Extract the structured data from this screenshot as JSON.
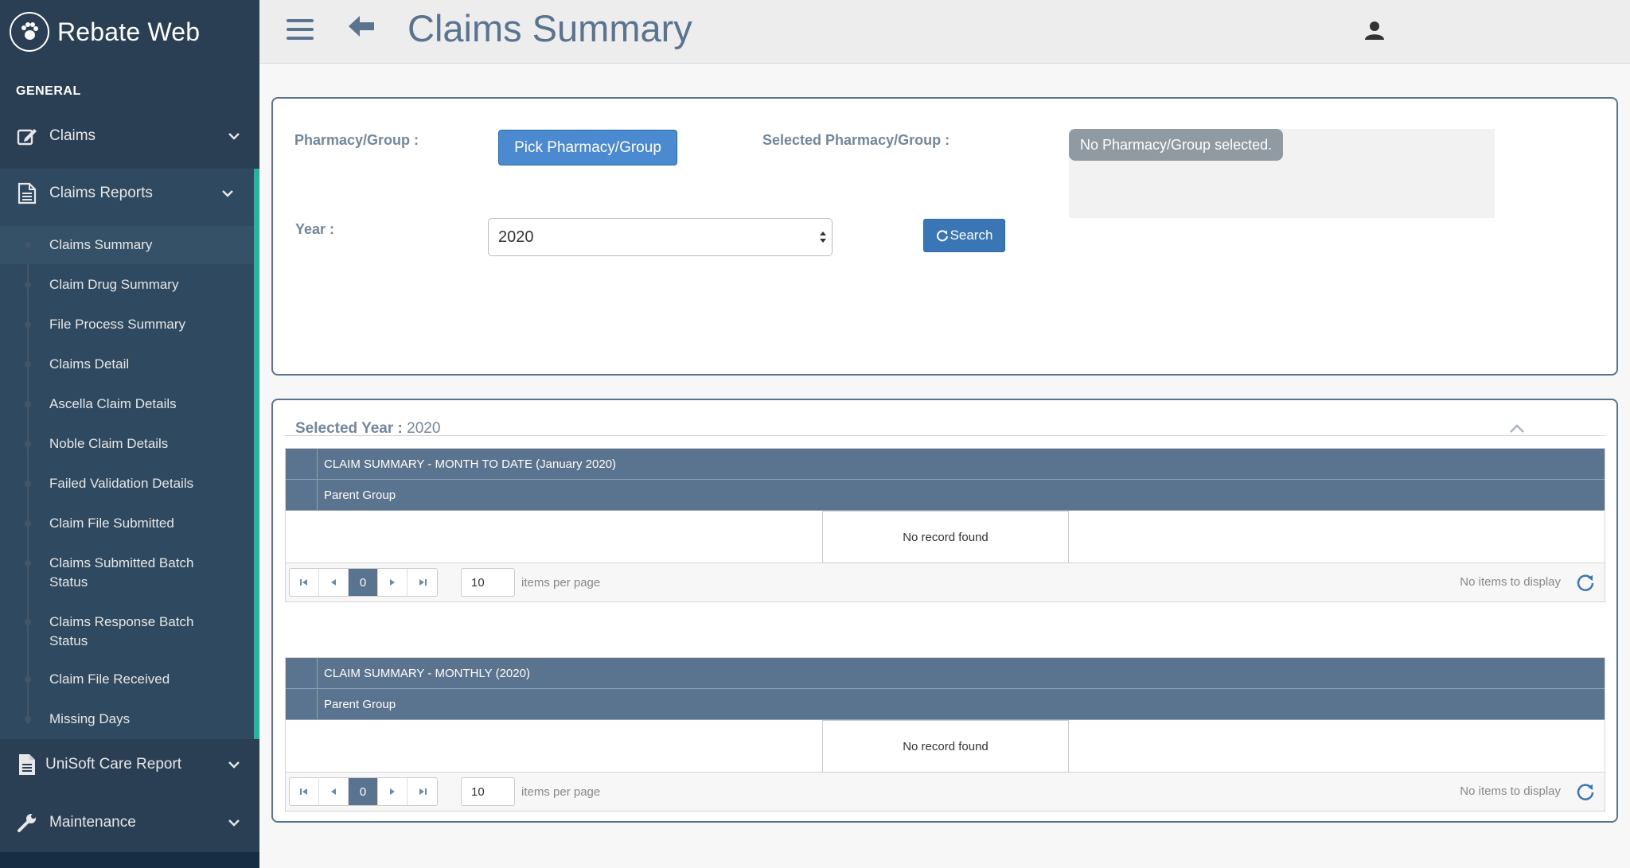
{
  "brand": {
    "name": "Rebate Web"
  },
  "sidebar": {
    "section_title": "GENERAL",
    "menu": [
      {
        "label": "Claims",
        "icon": "edit-icon"
      },
      {
        "label": "Claims Reports",
        "icon": "document-icon"
      },
      {
        "label": "UniSoft Care Report",
        "icon": "file-icon"
      },
      {
        "label": "Maintenance",
        "icon": "wrench-icon"
      }
    ],
    "submenu": [
      "Claims Summary",
      "Claim Drug Summary",
      "File Process Summary",
      "Claims Detail",
      "Ascella Claim Details",
      "Noble Claim Details",
      "Failed Validation Details",
      "Claim File Submitted",
      "Claims Submitted Batch Status",
      "Claims Response Batch Status",
      "Claim File Received",
      "Missing Days"
    ]
  },
  "header": {
    "title": "Claims Summary"
  },
  "filter": {
    "pharmacy_label": "Pharmacy/Group :",
    "pick_button": "Pick Pharmacy/Group",
    "selected_label": "Selected Pharmacy/Group :",
    "selected_value": "No Pharmacy/Group selected.",
    "year_label": "Year :",
    "year_value": "2020",
    "search_button": "Search"
  },
  "results": {
    "selected_year_label": "Selected Year :",
    "selected_year_value": "2020",
    "grids": [
      {
        "title": "CLAIM SUMMARY - MONTH TO DATE (January 2020)",
        "column": "Parent Group",
        "empty_text": "No record found",
        "page": "0",
        "page_size": "10",
        "items_per_page": "items per page",
        "no_items": "No items to display"
      },
      {
        "title": "CLAIM SUMMARY - MONTHLY (2020)",
        "column": "Parent Group",
        "empty_text": "No record found",
        "page": "0",
        "page_size": "10",
        "items_per_page": "items per page",
        "no_items": "No items to display"
      }
    ]
  },
  "colors": {
    "sidebar": "#2a3f54",
    "accent": "#1abb9c",
    "header": "#5a738e",
    "primary": "#4b89d0"
  }
}
